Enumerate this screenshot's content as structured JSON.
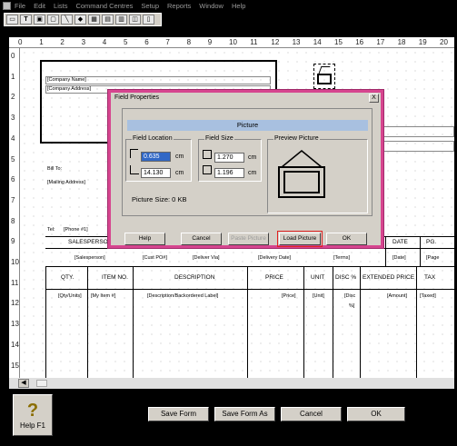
{
  "menu": [
    "File",
    "Edit",
    "Lists",
    "Command Centres",
    "Setup",
    "Reports",
    "Window",
    "Help"
  ],
  "toolbar_icons": [
    "select-icon",
    "text-icon",
    "field-icon",
    "picture-icon",
    "line-icon",
    "shade-icon",
    "graphic-icon",
    "table-icon",
    "properties-icon",
    "center-icon",
    "preview-icon"
  ],
  "ruler": {
    "h": [
      "0",
      "1",
      "2",
      "3",
      "4",
      "5",
      "6",
      "7",
      "8",
      "9",
      "10",
      "11",
      "12",
      "13",
      "14",
      "15",
      "16",
      "17",
      "18",
      "19",
      "20"
    ],
    "v": [
      "0",
      "1",
      "2",
      "3",
      "4",
      "5",
      "6",
      "7",
      "8",
      "9",
      "10",
      "11",
      "12",
      "13",
      "14",
      "15"
    ]
  },
  "form": {
    "company_name": "[Company Name]",
    "company_address": "[Company Address]",
    "bill_to": "Bill To:",
    "mailing_address": "[Mailing Address]",
    "tel_label": "Tel:",
    "phone": "[Phone #1]",
    "salesperson_hdr": "SALESPERSON",
    "date_hdr": "DATE",
    "pg_hdr": "PG.",
    "salesperson": "[Salesperson]",
    "cust_po": "[Cust PO#]",
    "deliver_via": "[Deliver Via]",
    "delivery_date": "[Delivery Date]",
    "terms": "[Terms]",
    "date": "[Date]",
    "page": "[Page",
    "cols": [
      "QTY.",
      "ITEM NO.",
      "DESCRIPTION",
      "PRICE",
      "UNIT",
      "DISC %",
      "EXTENDED PRICE",
      "TAX"
    ],
    "fields": [
      "[Qty/Units]",
      "[My Item #]",
      "[Description/Backordered Label]",
      "[Price]",
      "[Unit]",
      "[Disc",
      "%]",
      "[Amount]",
      "[Taxed]"
    ]
  },
  "dialog": {
    "title": "Field Properties",
    "close": "X",
    "header": "Picture",
    "field_location": "Field Location",
    "loc_top": "0.635",
    "loc_left": "14.130",
    "field_size": "Field Size",
    "size_h": "1.270",
    "size_w": "1.196",
    "unit": "cm",
    "preview_picture": "Preview Picture",
    "picture_size": "Picture Size: 0 KB",
    "buttons": {
      "help": "Help",
      "cancel": "Cancel",
      "paste": "Paste Picture",
      "load": "Load Picture",
      "ok": "OK"
    }
  },
  "bottom": {
    "help": "Help F1",
    "save_form": "Save Form",
    "save_form_as": "Save Form As",
    "cancel": "Cancel",
    "ok": "OK"
  }
}
